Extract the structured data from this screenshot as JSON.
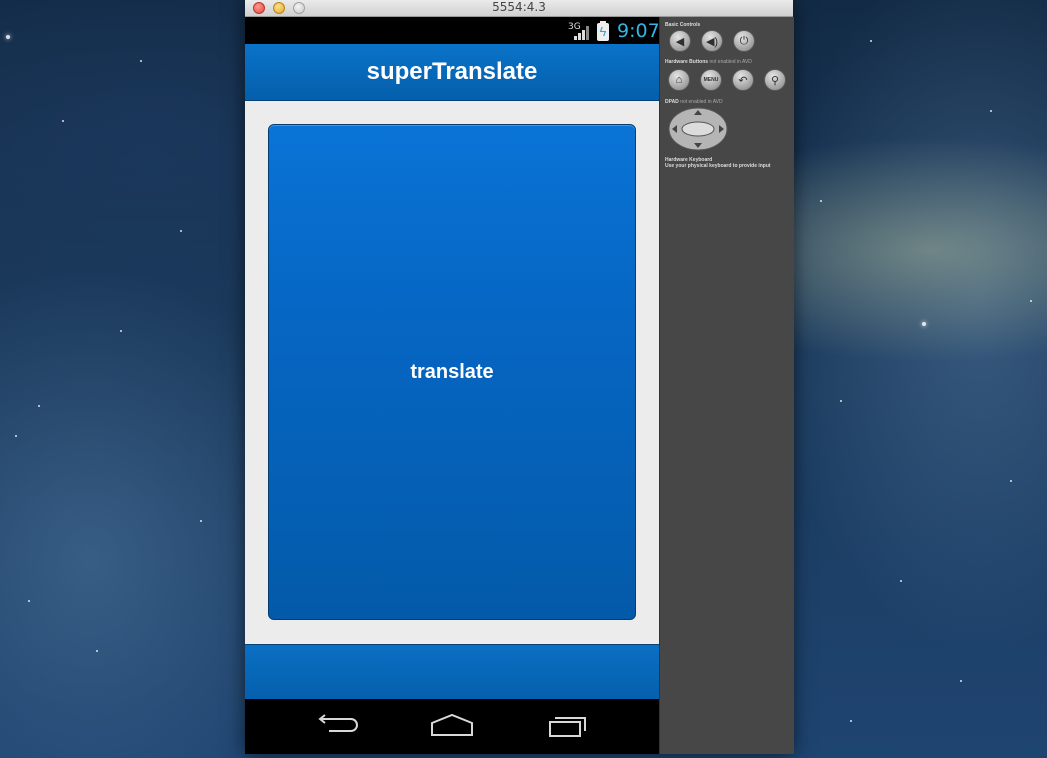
{
  "window": {
    "title": "5554:4.3"
  },
  "statusbar": {
    "network": "3G",
    "time": "9:07"
  },
  "app": {
    "title": "superTranslate",
    "button_label": "translate"
  },
  "navbar": {
    "back": "back-icon",
    "home": "home-icon",
    "recents": "recents-icon"
  },
  "panel": {
    "basic_controls": "Basic Controls",
    "hardware_buttons": "Hardware Buttons",
    "hardware_buttons_note": "not enabled in AVD",
    "dpad": "DPAD",
    "dpad_note": "not enabled in AVD",
    "keyboard_title": "Hardware Keyboard",
    "keyboard_note": "Use your physical keyboard to provide input",
    "menu_label": "MENU"
  },
  "colors": {
    "accent": "#33b5e5",
    "action_bar": "#0a73c9",
    "button": "#0667c5",
    "background": "#ececec"
  }
}
